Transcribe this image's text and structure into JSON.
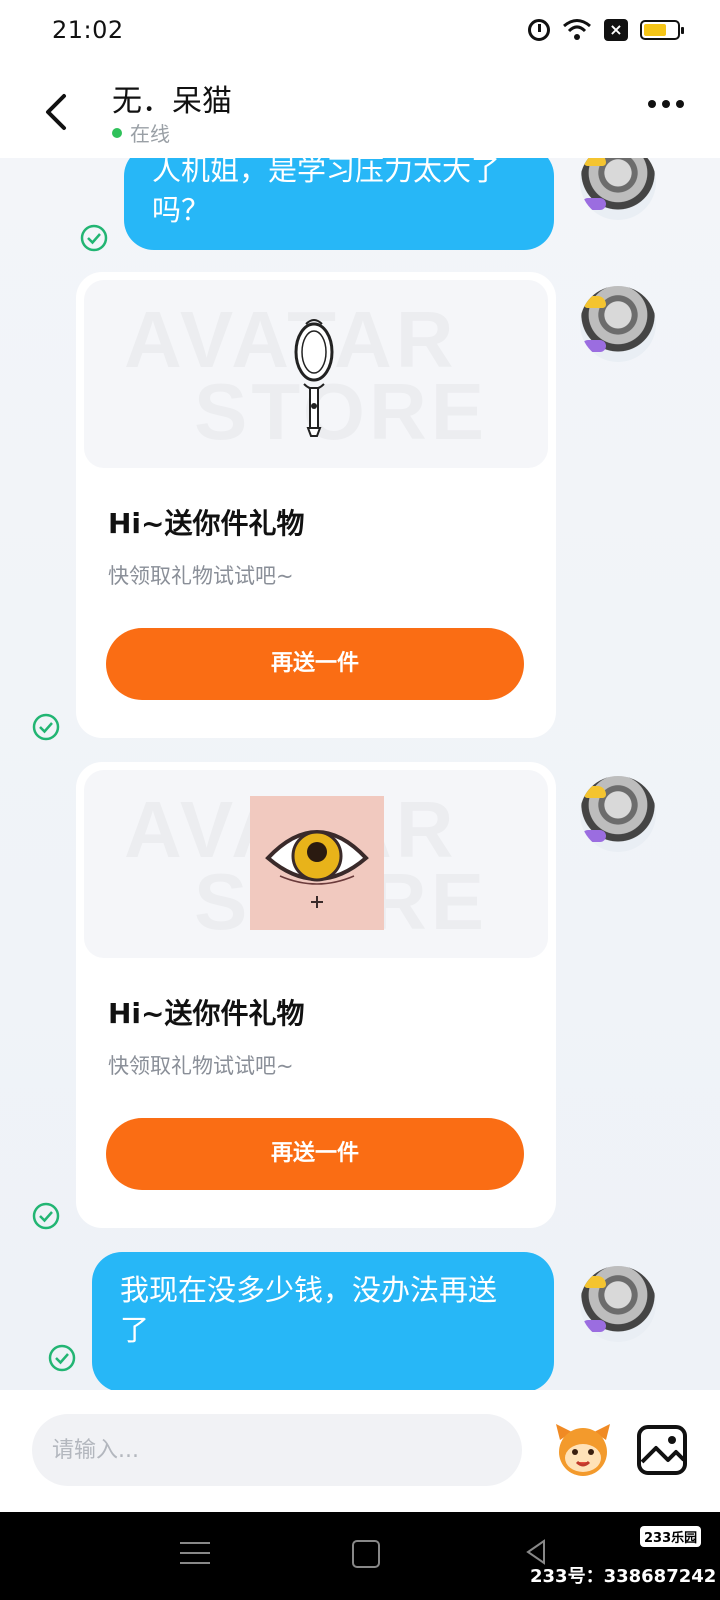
{
  "status_bar": {
    "time": "21:02",
    "icons": [
      "alarm-icon",
      "wifi-icon",
      "close-box-icon",
      "battery-icon"
    ],
    "battery_color": "#f5c518"
  },
  "header": {
    "title": "无．呆猫",
    "status": "在线",
    "status_color": "#2fc15a",
    "back_icon": "back-arrow-icon",
    "more_icon": "more-dots-icon"
  },
  "messages": [
    {
      "type": "text",
      "text_line1": "人机姐，是学习压力太大了",
      "text_line2": "吗？",
      "status_icon": "check-icon"
    },
    {
      "type": "gift",
      "gift_icon": "hand-mirror-icon",
      "watermark_line1": "AVATAR",
      "watermark_line2": "STORE",
      "title": "Hi~送你件礼物",
      "subtitle": "快领取礼物试试吧~",
      "button": "再送一件",
      "status_icon": "check-icon"
    },
    {
      "type": "gift",
      "gift_icon": "eye-image-icon",
      "watermark_line1": "AVATAR",
      "watermark_line2": "STORE",
      "title": "Hi~送你件礼物",
      "subtitle": "快领取礼物试试吧~",
      "button": "再送一件",
      "status_icon": "check-icon"
    },
    {
      "type": "text",
      "text_line1": "我现在没多少钱，没办法再送",
      "text_line2": "了",
      "status_icon": "check-icon"
    }
  ],
  "input_bar": {
    "placeholder": "请输入...",
    "mascot_icon": "mascot-icon",
    "image_icon": "image-icon"
  },
  "nav_bar": {
    "icons": [
      "menu-icon",
      "home-icon",
      "back-triangle-icon"
    ],
    "watermark_logo": "233乐园",
    "watermark_id": "233号：338687242"
  },
  "colors": {
    "bubble": "#27b7f7",
    "button": "#fa6d14",
    "check": "#22b573"
  }
}
